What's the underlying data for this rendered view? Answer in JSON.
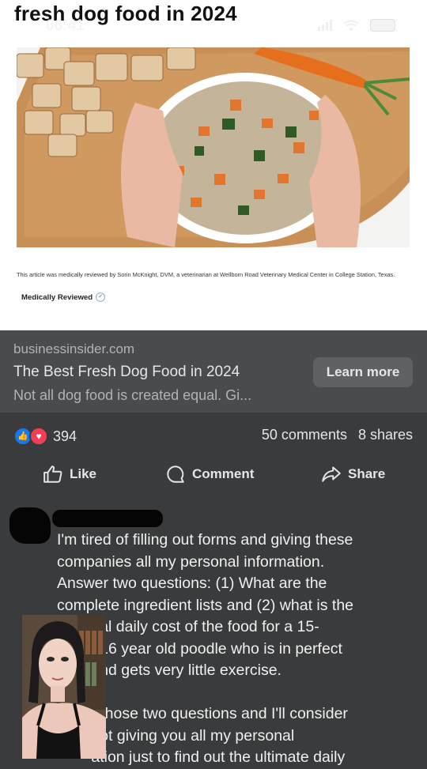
{
  "status_bar": {
    "time": "06:41"
  },
  "article": {
    "headline": "fresh dog food in 2024",
    "caption": "This article was medically reviewed by Sorin McKnight, DVM, a veterinarian at Wellborn Road Veterinary Medical Center in College Station, Texas.",
    "medically_reviewed": "Medically Reviewed"
  },
  "link_card": {
    "domain": "businessinsider.com",
    "title": "The Best Fresh Dog Food in 2024",
    "description": "Not all dog food is created equal. Gi...",
    "cta": "Learn more"
  },
  "engagement": {
    "reaction_count": "394",
    "comments": "50 comments",
    "shares": "8 shares"
  },
  "actions": {
    "like": "Like",
    "comment": "Comment",
    "share": "Share"
  },
  "comment": {
    "text": "I'm tired of filling out forms and giving these\ncompanies all my personal information.\nAnswer two questions: (1) What are the\ncomplete ingredient lists and (2) what is the\n        ual daily cost of the food for a 15-\n        , 16 year old poodle who is in perfect\n        and gets very little exercise.\n\n        r those two questions and I'll consider\n        not giving you all my personal\n        ation just to find out the ultimate daily"
  },
  "colors": {
    "card_bg": "#4a4b4c",
    "feed_bg": "#3a3b3c",
    "like_blue": "#1877f2",
    "love_red": "#f33e58"
  }
}
